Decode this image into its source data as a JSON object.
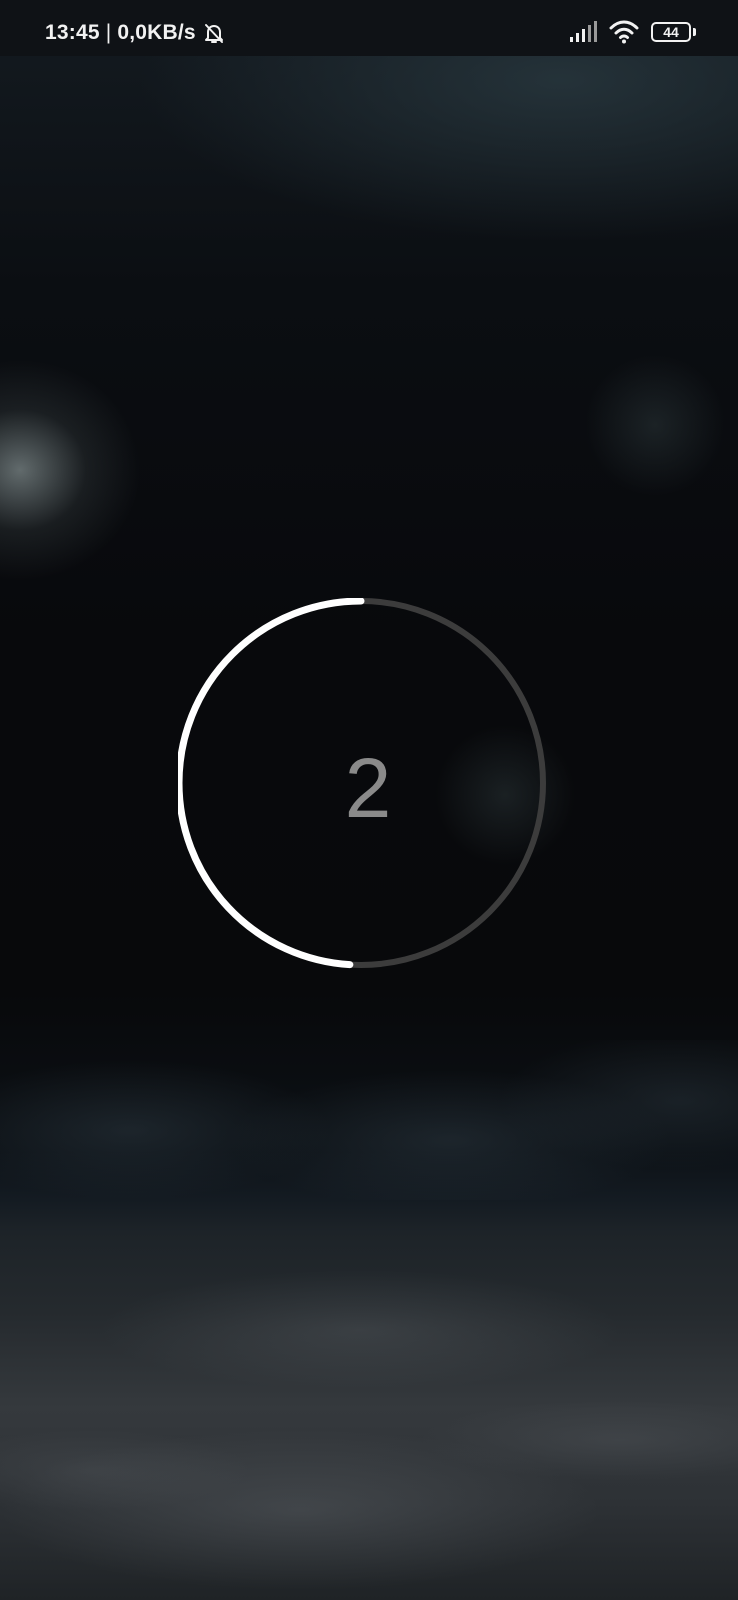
{
  "status_bar": {
    "time": "13:45",
    "separator": "|",
    "network_speed": "0,0KB/s",
    "battery_level": "44",
    "icons": [
      "mute-notifications-icon",
      "signal-icon",
      "wifi-icon",
      "battery-icon"
    ]
  },
  "countdown": {
    "value": "2",
    "progress_fraction": 0.49,
    "colors": {
      "progress": "#ffffff",
      "track": "#3c3c3c",
      "number": "#8a8a8a"
    }
  }
}
